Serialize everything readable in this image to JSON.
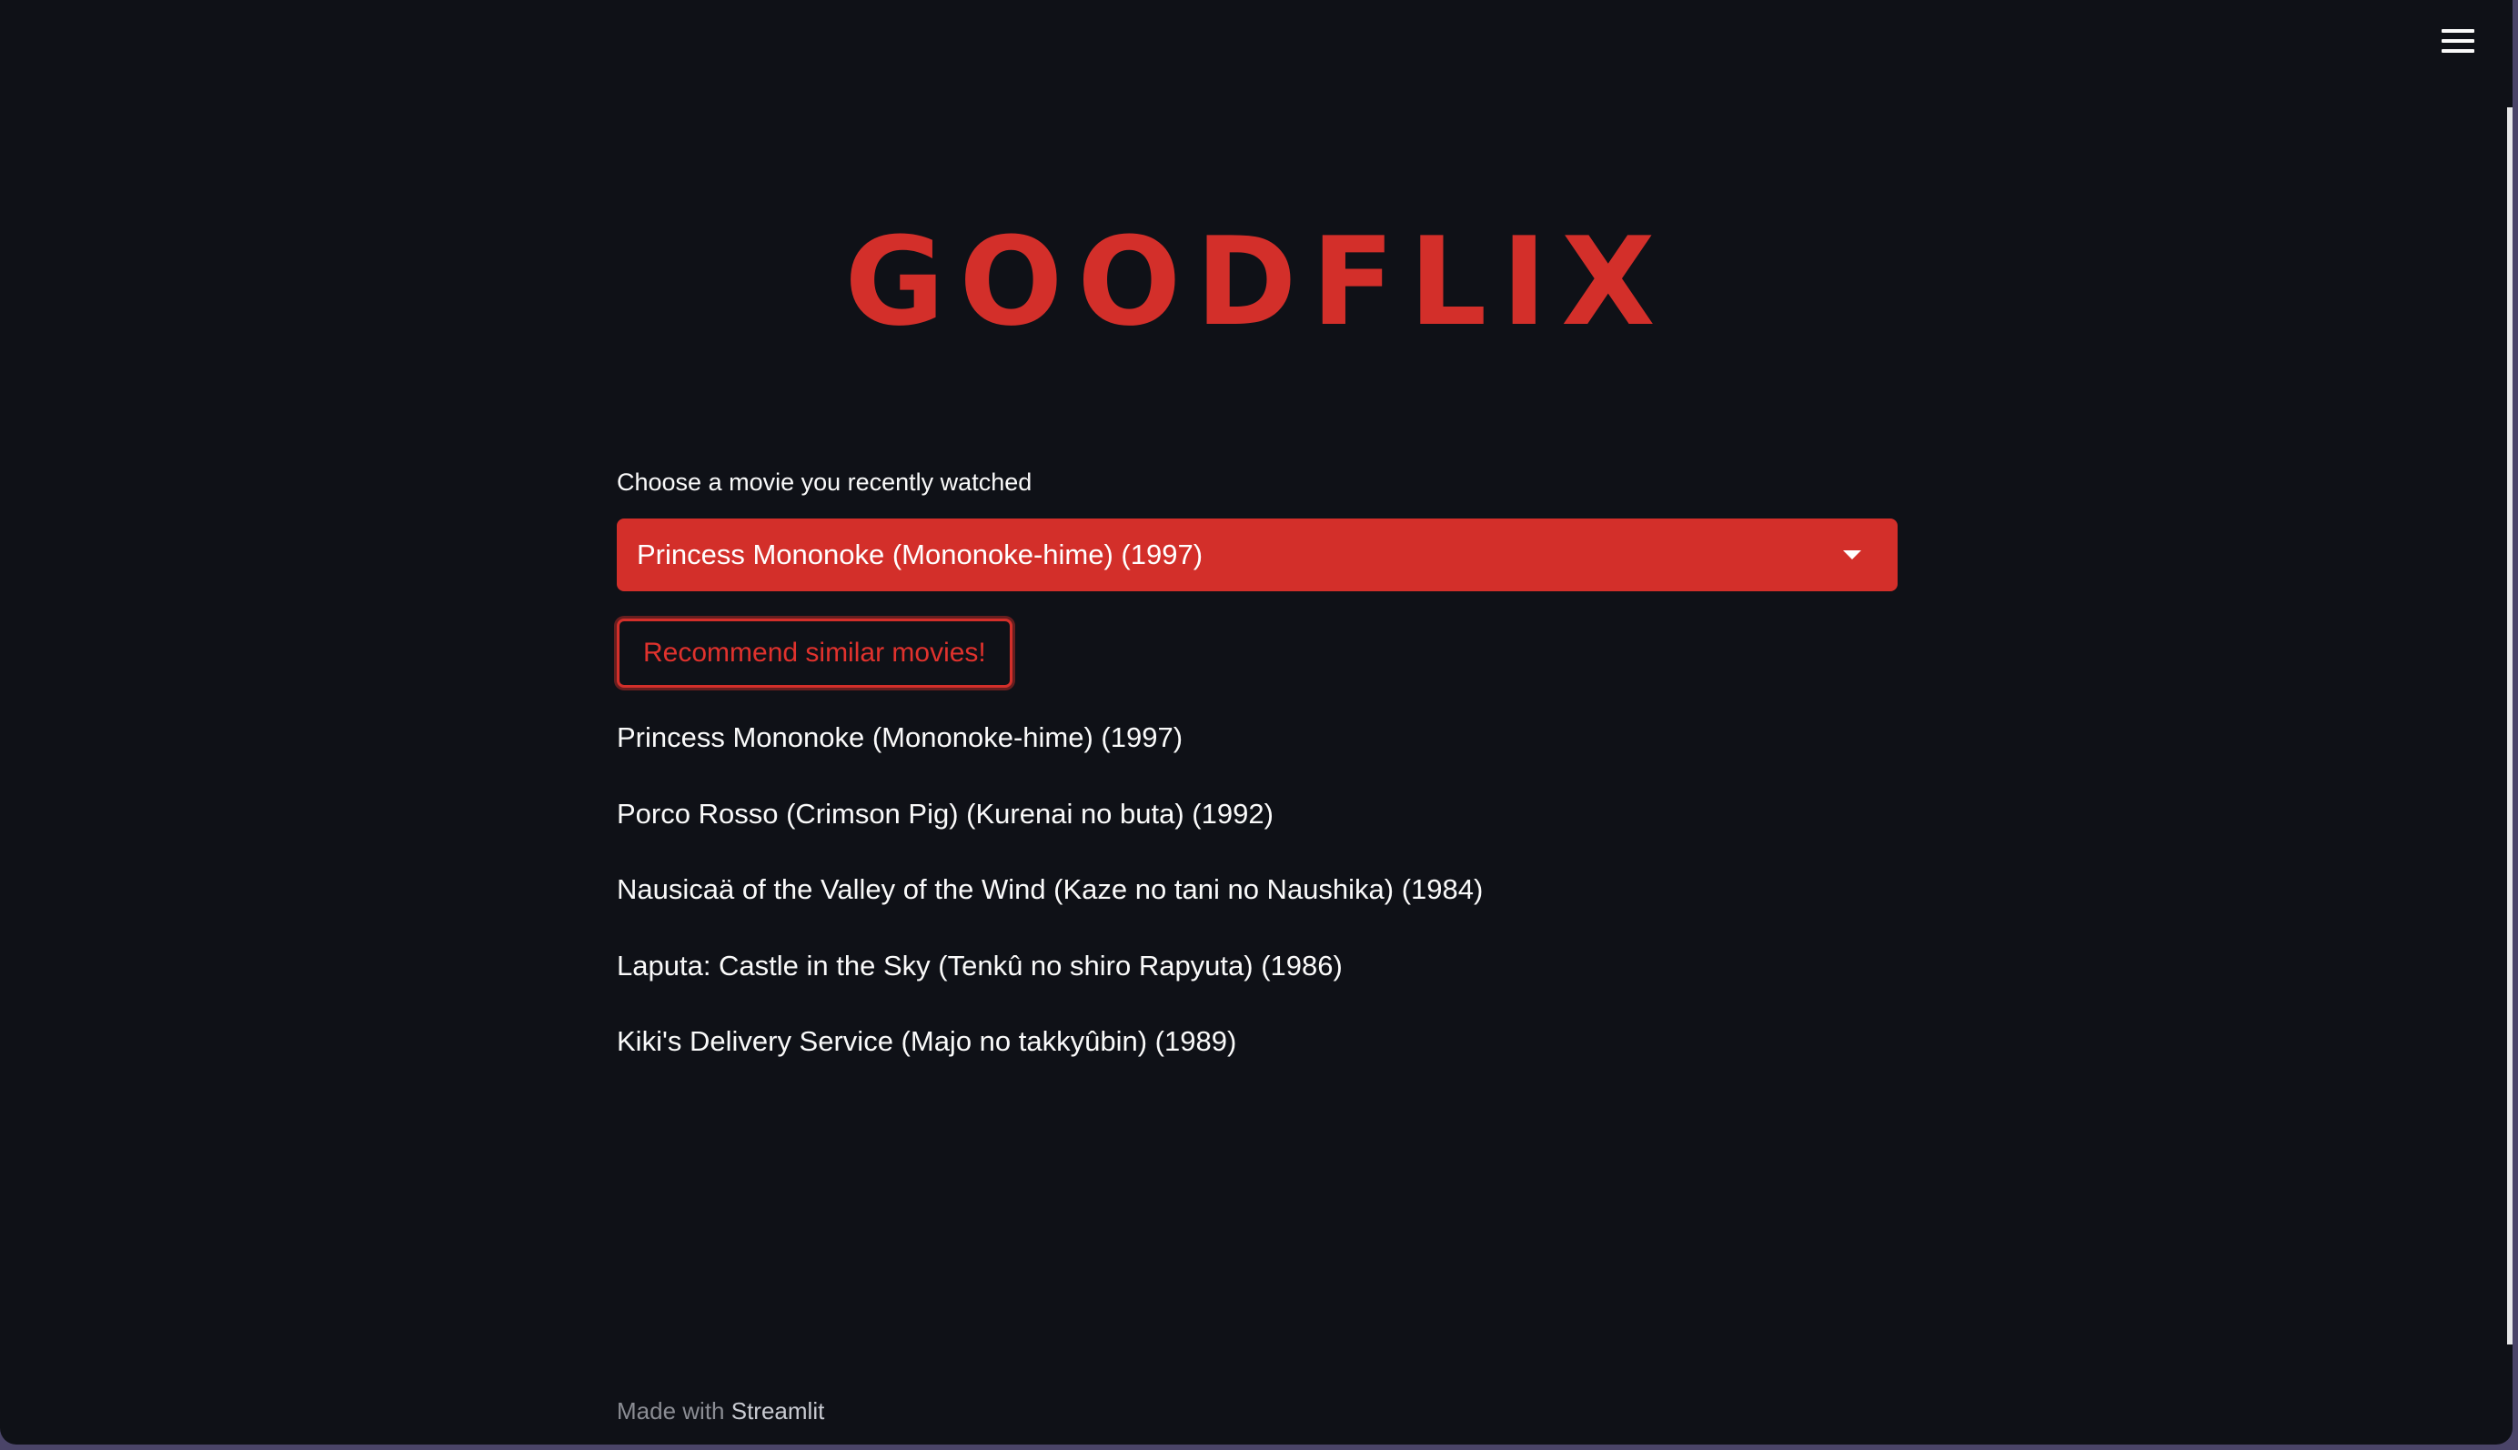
{
  "app": {
    "title": "GOODFLIX"
  },
  "header": {
    "menu_icon": "hamburger-menu-icon"
  },
  "movie_select": {
    "label": "Choose a movie you recently watched",
    "selected_value": "Princess Mononoke (Mononoke-hime) (1997)",
    "icon": "chevron-down-icon"
  },
  "recommend_button": {
    "label": "Recommend similar movies!"
  },
  "results": [
    "Princess Mononoke (Mononoke-hime) (1997)",
    "Porco Rosso (Crimson Pig) (Kurenai no buta) (1992)",
    "Nausicaä of the Valley of the Wind (Kaze no tani no Naushika) (1984)",
    "Laputa: Castle in the Sky (Tenkû no shiro Rapyuta) (1986)",
    "Kiki's Delivery Service (Majo no takkyûbin) (1989)"
  ],
  "footer": {
    "prefix": "Made with",
    "link": "Streamlit"
  },
  "colors": {
    "background": "#0f1117",
    "accent": "#d32f2a",
    "text": "#fafafa"
  }
}
